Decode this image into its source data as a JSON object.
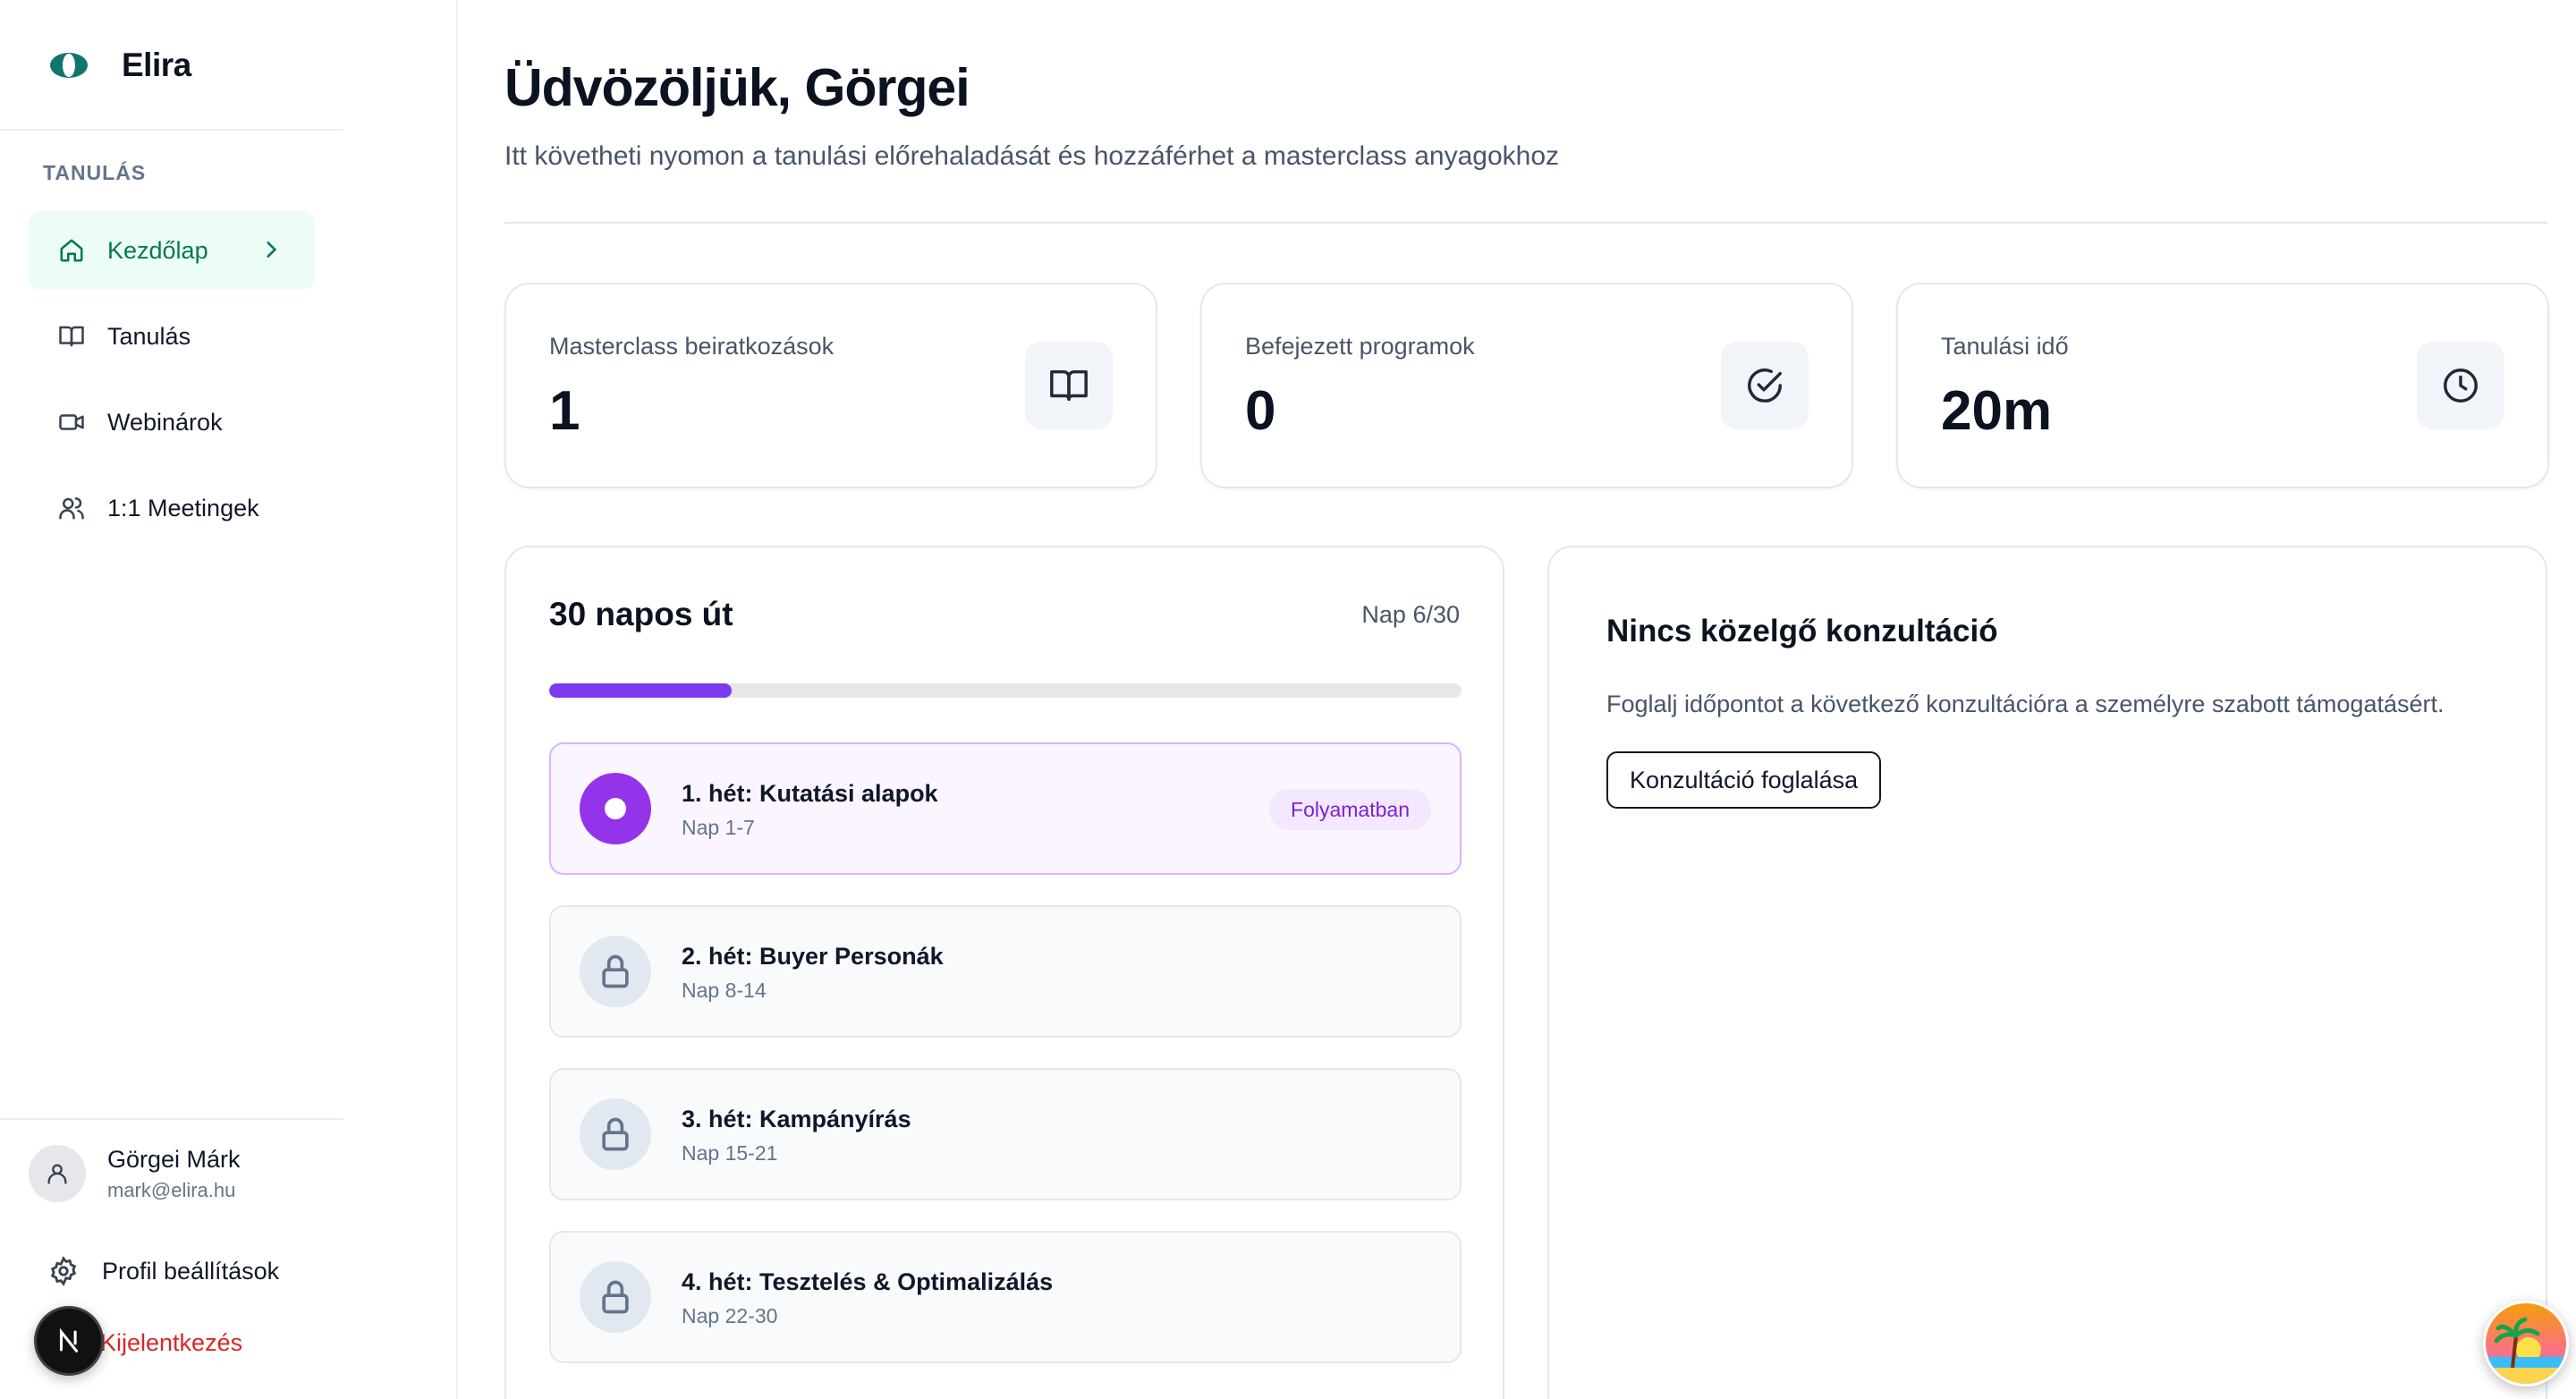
{
  "brand": {
    "name": "Elira"
  },
  "sidebar": {
    "section_label": "TANULÁS",
    "items": [
      {
        "label": "Kezdőlap",
        "icon": "home-icon",
        "active": true
      },
      {
        "label": "Tanulás",
        "icon": "book-open-icon",
        "active": false
      },
      {
        "label": "Webinárok",
        "icon": "video-icon",
        "active": false
      },
      {
        "label": "1:1 Meetingek",
        "icon": "users-icon",
        "active": false
      }
    ],
    "user": {
      "name": "Görgei Márk",
      "email": "mark@elira.hu"
    },
    "profile_settings": "Profil beállítások",
    "logout": "Kijelentkezés"
  },
  "header": {
    "title": "Üdvözöljük, Görgei",
    "subtitle": "Itt követheti nyomon a tanulási előrehaladását és hozzáférhet a masterclass anyagokhoz"
  },
  "stats": [
    {
      "label": "Masterclass beiratkozások",
      "value": "1",
      "icon": "book-open-icon"
    },
    {
      "label": "Befejezett programok",
      "value": "0",
      "icon": "check-circle-icon"
    },
    {
      "label": "Tanulási idő",
      "value": "20m",
      "icon": "clock-icon"
    }
  ],
  "journey": {
    "title": "30 napos út",
    "day": "Nap 6/30",
    "progress_fraction": 0.2,
    "weeks": [
      {
        "title": "1. hét: Kutatási alapok",
        "sub": "Nap 1-7",
        "status": "Folyamatban"
      },
      {
        "title": "2. hét: Buyer Personák",
        "sub": "Nap 8-14"
      },
      {
        "title": "3. hét: Kampányírás",
        "sub": "Nap 15-21"
      },
      {
        "title": "4. hét: Tesztelés & Optimalizálás",
        "sub": "Nap 22-30"
      }
    ]
  },
  "consultation": {
    "title": "Nincs közelgő konzultáció",
    "text": "Foglalj időpontot a következő konzultációra a személyre szabott támogatásért.",
    "button": "Konzultáció foglalása"
  },
  "colors": {
    "accent_green": "#047857",
    "accent_purple": "#7c3aed",
    "danger": "#dc2626"
  }
}
